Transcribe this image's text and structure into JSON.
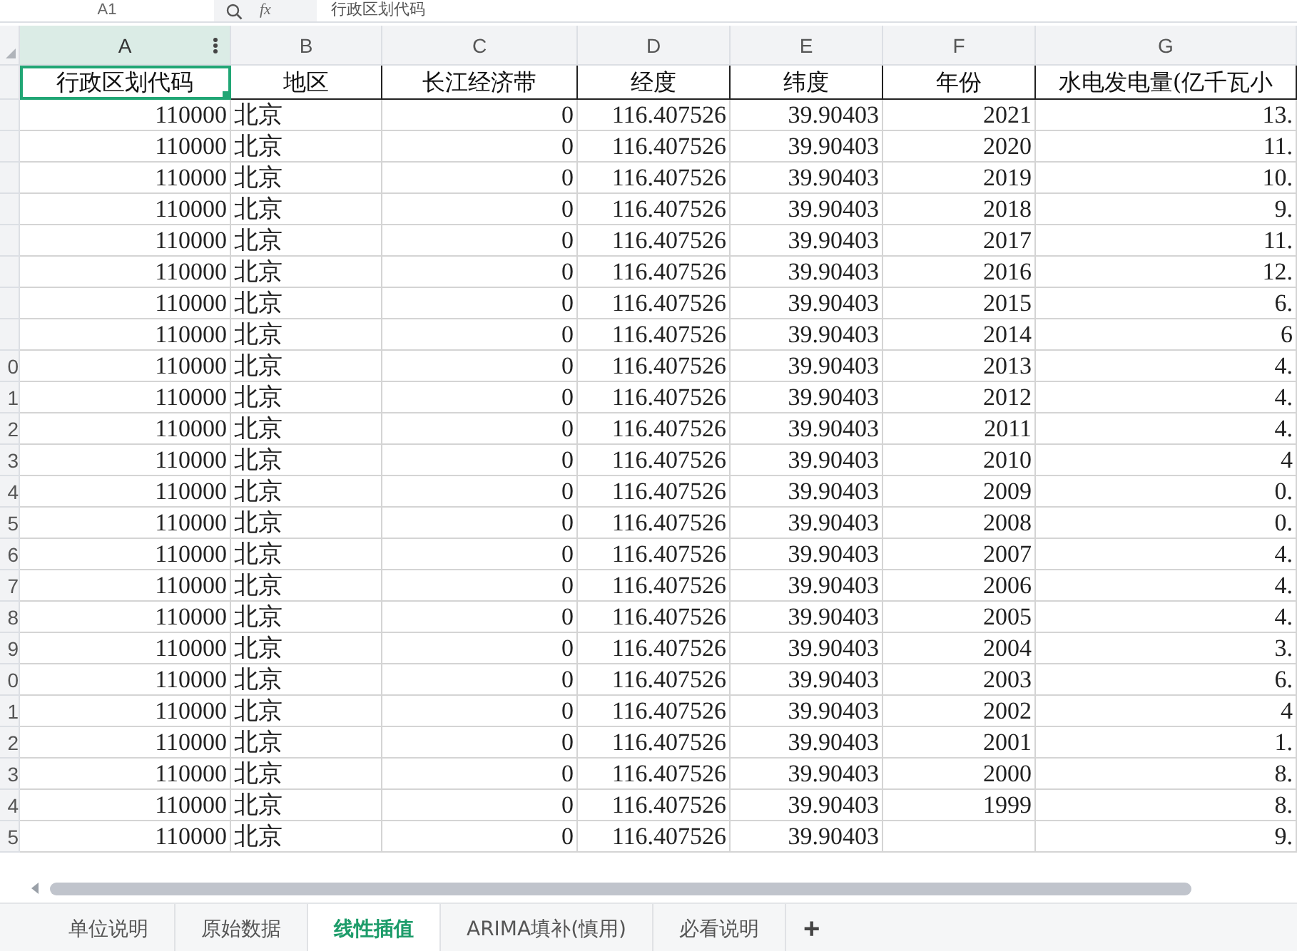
{
  "formula_bar": {
    "cell_name": "A1",
    "function_label": "fx",
    "formula": "行政区划代码"
  },
  "columns": [
    {
      "label": "A",
      "selected": true
    },
    {
      "label": "B",
      "selected": false
    },
    {
      "label": "C",
      "selected": false
    },
    {
      "label": "D",
      "selected": false
    },
    {
      "label": "E",
      "selected": false
    },
    {
      "label": "F",
      "selected": false
    },
    {
      "label": "G",
      "selected": false
    }
  ],
  "header_row": [
    {
      "text": "行政区划代码",
      "selected": true
    },
    {
      "text": "地区",
      "selected": false
    },
    {
      "text": "长江经济带",
      "selected": false
    },
    {
      "text": "经度",
      "selected": false
    },
    {
      "text": "纬度",
      "selected": false
    },
    {
      "text": "年份",
      "selected": false
    },
    {
      "text": "水电发电量(亿千瓦小",
      "selected": false
    }
  ],
  "rows": [
    {
      "cells": [
        "110000",
        "北京",
        "0",
        "116.407526",
        "39.90403",
        "2021",
        "13."
      ]
    },
    {
      "cells": [
        "110000",
        "北京",
        "0",
        "116.407526",
        "39.90403",
        "2020",
        "11."
      ]
    },
    {
      "cells": [
        "110000",
        "北京",
        "0",
        "116.407526",
        "39.90403",
        "2019",
        "10."
      ]
    },
    {
      "cells": [
        "110000",
        "北京",
        "0",
        "116.407526",
        "39.90403",
        "2018",
        "9."
      ]
    },
    {
      "cells": [
        "110000",
        "北京",
        "0",
        "116.407526",
        "39.90403",
        "2017",
        "11."
      ]
    },
    {
      "cells": [
        "110000",
        "北京",
        "0",
        "116.407526",
        "39.90403",
        "2016",
        "12."
      ]
    },
    {
      "cells": [
        "110000",
        "北京",
        "0",
        "116.407526",
        "39.90403",
        "2015",
        "6."
      ]
    },
    {
      "cells": [
        "110000",
        "北京",
        "0",
        "116.407526",
        "39.90403",
        "2014",
        "6"
      ]
    },
    {
      "row_label": "0",
      "cells": [
        "110000",
        "北京",
        "0",
        "116.407526",
        "39.90403",
        "2013",
        "4."
      ]
    },
    {
      "row_label": "1",
      "cells": [
        "110000",
        "北京",
        "0",
        "116.407526",
        "39.90403",
        "2012",
        "4."
      ]
    },
    {
      "row_label": "2",
      "cells": [
        "110000",
        "北京",
        "0",
        "116.407526",
        "39.90403",
        "2011",
        "4."
      ]
    },
    {
      "row_label": "3",
      "cells": [
        "110000",
        "北京",
        "0",
        "116.407526",
        "39.90403",
        "2010",
        "4"
      ]
    },
    {
      "row_label": "4",
      "cells": [
        "110000",
        "北京",
        "0",
        "116.407526",
        "39.90403",
        "2009",
        "0."
      ]
    },
    {
      "row_label": "5",
      "cells": [
        "110000",
        "北京",
        "0",
        "116.407526",
        "39.90403",
        "2008",
        "0."
      ]
    },
    {
      "row_label": "6",
      "cells": [
        "110000",
        "北京",
        "0",
        "116.407526",
        "39.90403",
        "2007",
        "4."
      ]
    },
    {
      "row_label": "7",
      "cells": [
        "110000",
        "北京",
        "0",
        "116.407526",
        "39.90403",
        "2006",
        "4."
      ]
    },
    {
      "row_label": "8",
      "cells": [
        "110000",
        "北京",
        "0",
        "116.407526",
        "39.90403",
        "2005",
        "4."
      ]
    },
    {
      "row_label": "9",
      "cells": [
        "110000",
        "北京",
        "0",
        "116.407526",
        "39.90403",
        "2004",
        "3."
      ]
    },
    {
      "row_label": "0",
      "cells": [
        "110000",
        "北京",
        "0",
        "116.407526",
        "39.90403",
        "2003",
        "6."
      ]
    },
    {
      "row_label": "1",
      "cells": [
        "110000",
        "北京",
        "0",
        "116.407526",
        "39.90403",
        "2002",
        "4"
      ]
    },
    {
      "row_label": "2",
      "cells": [
        "110000",
        "北京",
        "0",
        "116.407526",
        "39.90403",
        "2001",
        "1."
      ]
    },
    {
      "row_label": "3",
      "cells": [
        "110000",
        "北京",
        "0",
        "116.407526",
        "39.90403",
        "2000",
        "8."
      ]
    },
    {
      "row_label": "4",
      "cells": [
        "110000",
        "北京",
        "0",
        "116.407526",
        "39.90403",
        "1999",
        "8."
      ]
    },
    {
      "row_label": "5",
      "cells": [
        "110000",
        "北京",
        "0",
        "116.407526",
        "39.90403",
        null,
        "9."
      ]
    }
  ],
  "sheet_tabs": [
    {
      "label": "单位说明",
      "selected": false
    },
    {
      "label": "原始数据",
      "selected": false
    },
    {
      "label": "线性插值",
      "selected": true
    },
    {
      "label": "ARIMA填补(慎用)",
      "selected": false
    },
    {
      "label": "必看说明",
      "selected": false
    }
  ],
  "add_sheet": "+"
}
